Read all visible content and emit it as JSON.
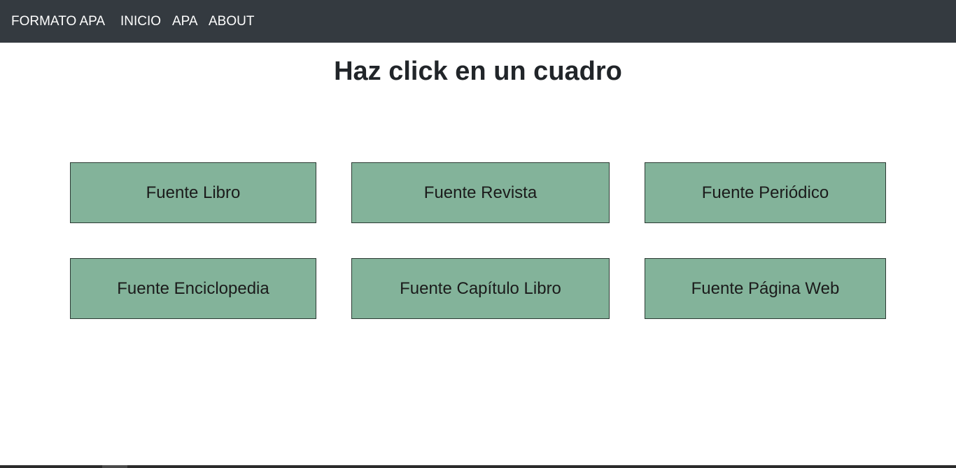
{
  "navbar": {
    "brand": "FORMATO APA",
    "links": [
      "INICIO",
      "APA",
      "ABOUT"
    ]
  },
  "main": {
    "title": "Haz click en un cuadro",
    "tiles": [
      "Fuente Libro",
      "Fuente Revista",
      "Fuente Periódico",
      "Fuente Enciclopedia",
      "Fuente Capítulo Libro",
      "Fuente Página Web"
    ]
  },
  "colors": {
    "navbar_bg": "#343a40",
    "tile_bg": "#83b39a",
    "tile_border": "#2b3a33",
    "title_text": "#212529"
  }
}
